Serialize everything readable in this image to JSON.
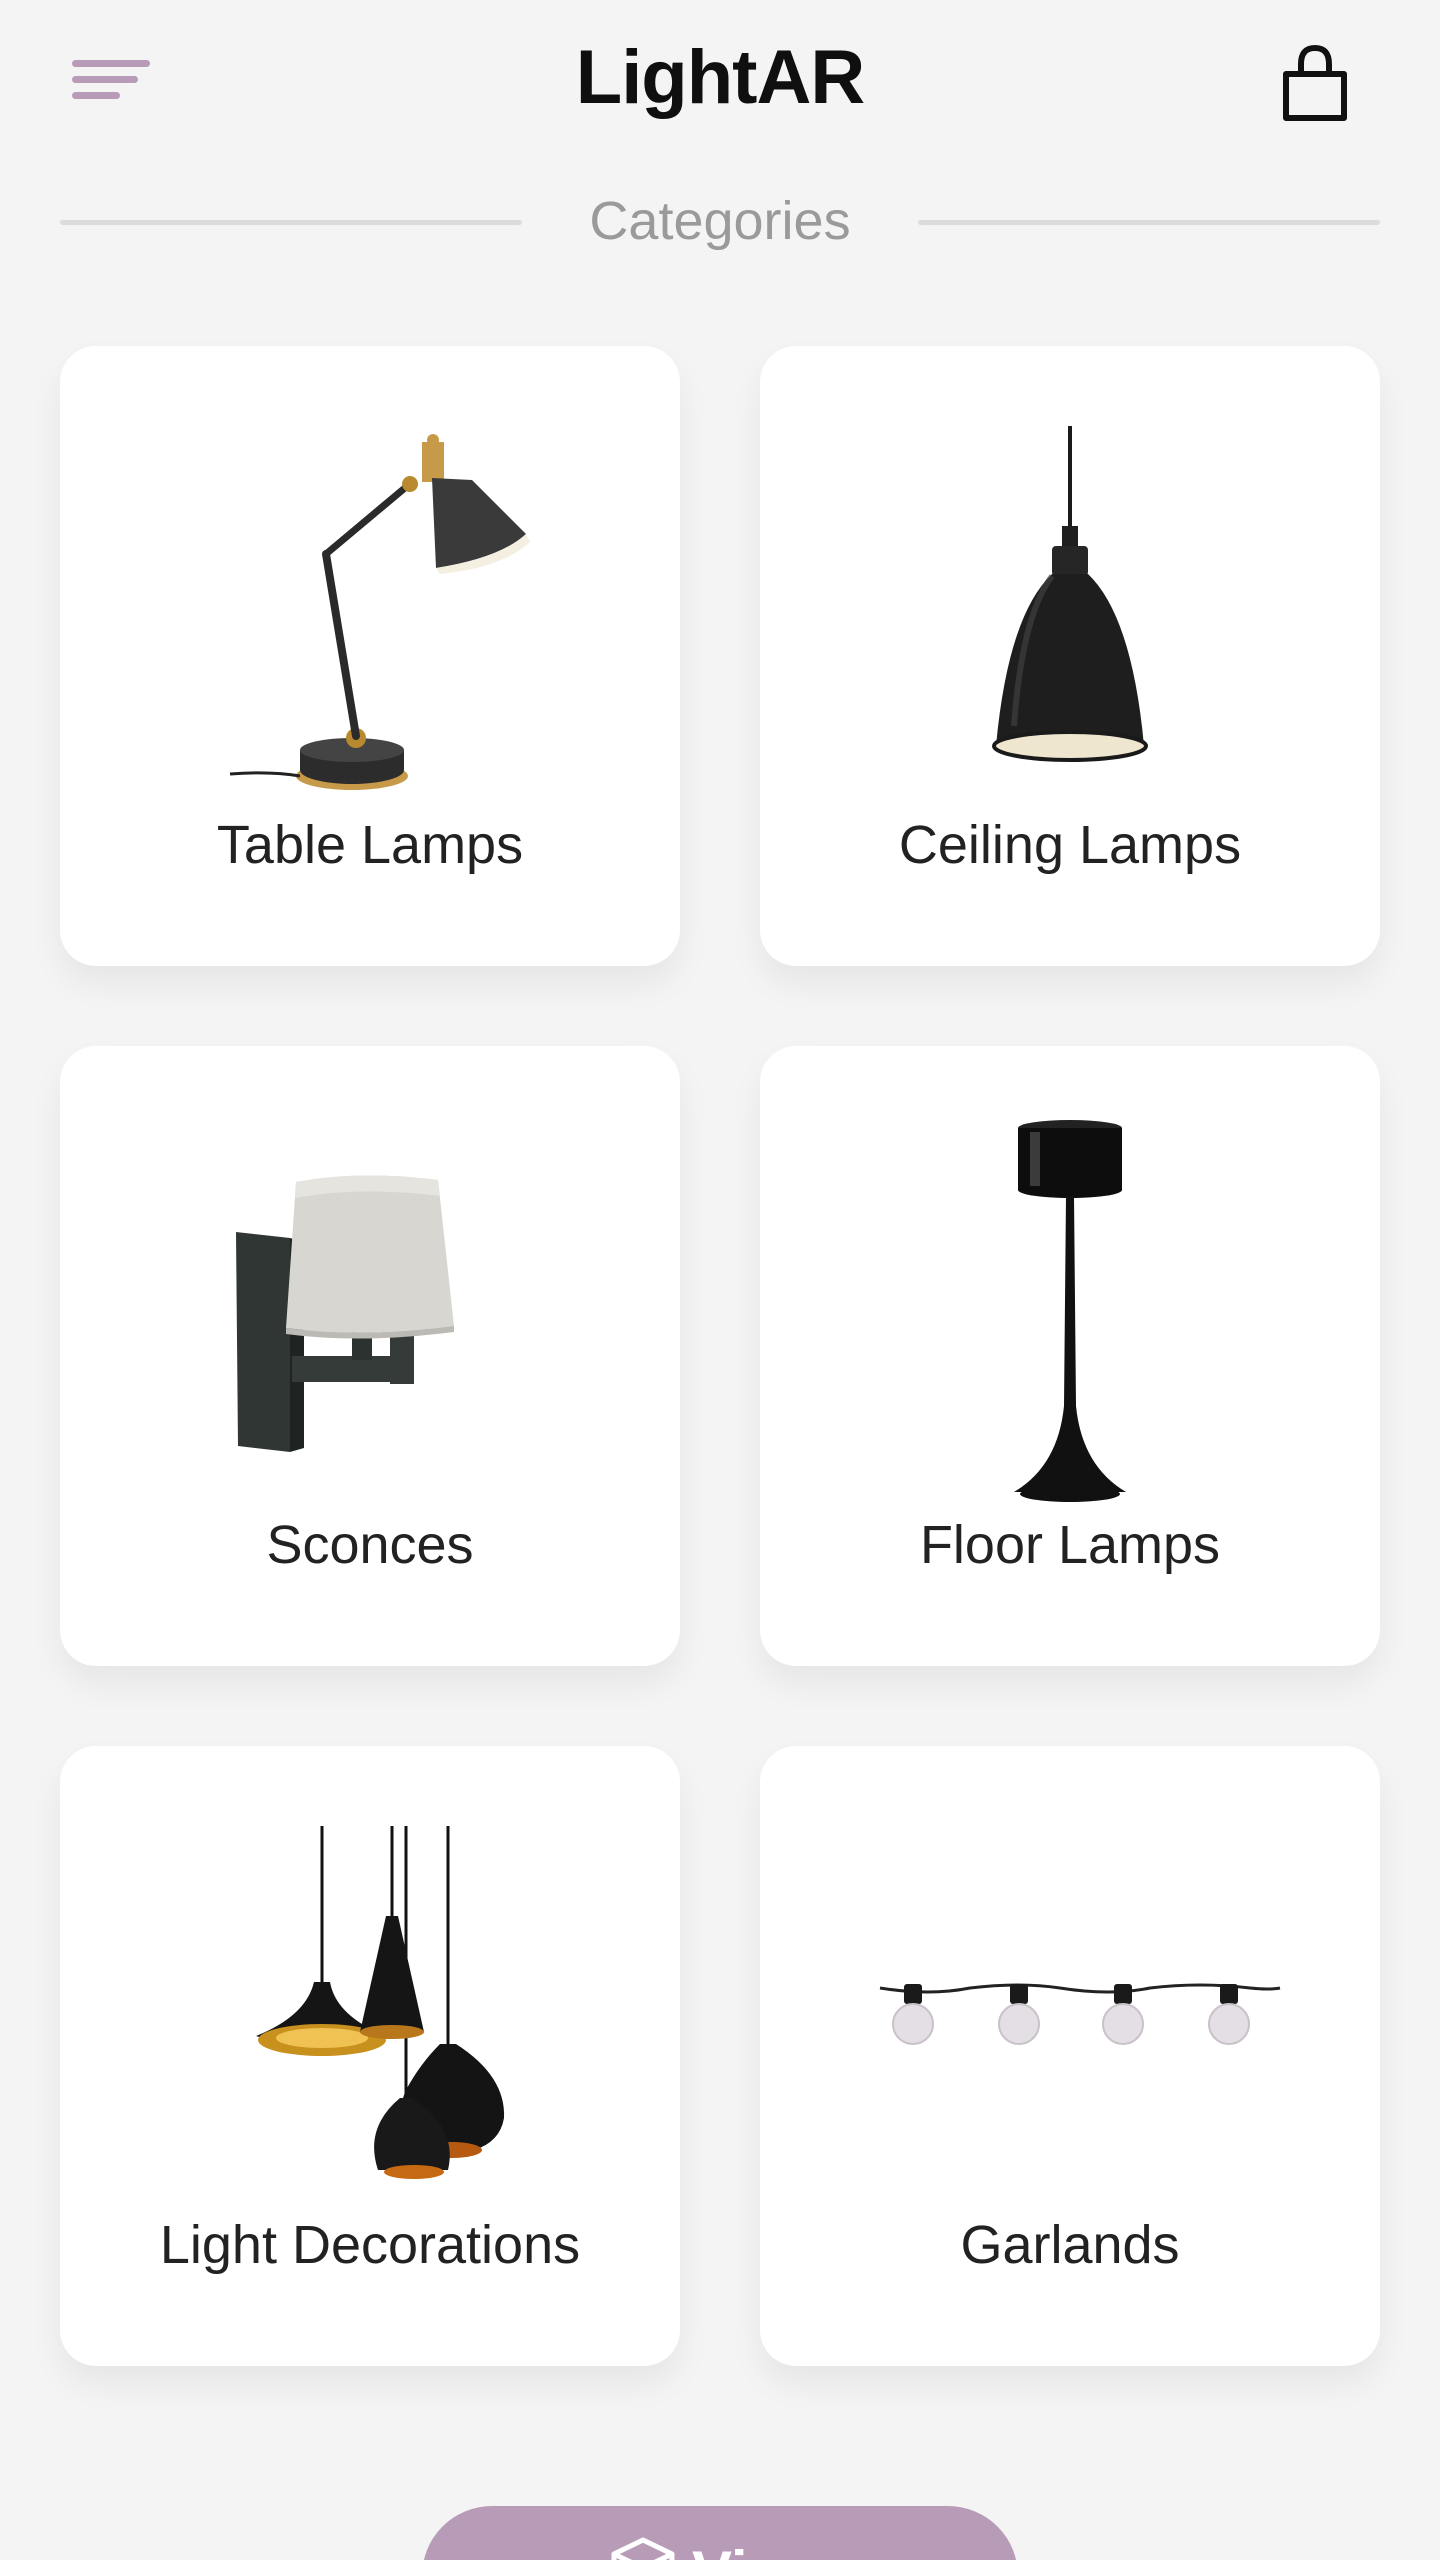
{
  "header": {
    "title": "LightAR",
    "menu_icon": "menu-icon",
    "cart_icon": "shopping-bag-icon"
  },
  "section": {
    "label": "Categories"
  },
  "categories": [
    {
      "label": "Table Lamps",
      "image": "table-lamp-image"
    },
    {
      "label": "Ceiling Lamps",
      "image": "ceiling-lamp-image"
    },
    {
      "label": "Sconces",
      "image": "sconce-image"
    },
    {
      "label": "Floor Lamps",
      "image": "floor-lamp-image"
    },
    {
      "label": "Light Decorations",
      "image": "light-decorations-image"
    },
    {
      "label": "Garlands",
      "image": "garland-image"
    }
  ],
  "bottom_button": {
    "label": "Vi",
    "icon": "ar-cube-icon"
  },
  "colors": {
    "background": "#f4f4f4",
    "accent": "#b89cb7",
    "card": "#ffffff",
    "text": "#222222",
    "muted": "#9a9a9a"
  }
}
